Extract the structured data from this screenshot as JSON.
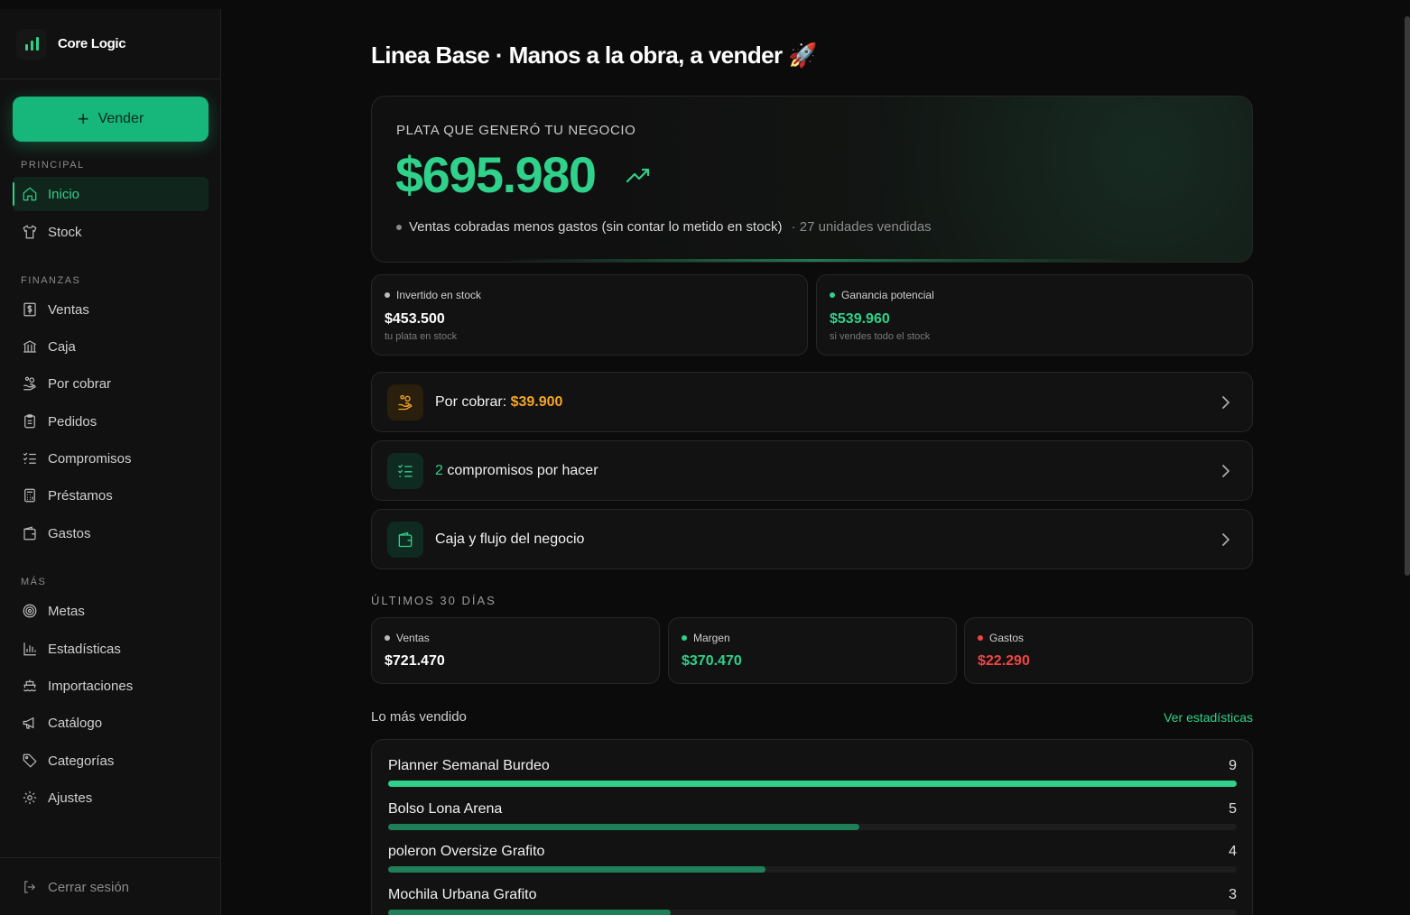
{
  "brand": {
    "name": "Core Logic"
  },
  "sidebar": {
    "sell_label": "Vender",
    "sections": {
      "principal": "PRINCIPAL",
      "finanzas": "FINANZAS",
      "mas": "MÁS"
    },
    "items": [
      {
        "label": "Inicio",
        "icon": "home-icon"
      },
      {
        "label": "Stock",
        "icon": "shirt-icon"
      },
      {
        "label": "Ventas",
        "icon": "dollar-receipt-icon"
      },
      {
        "label": "Caja",
        "icon": "bank-icon"
      },
      {
        "label": "Por cobrar",
        "icon": "hand-coins-icon"
      },
      {
        "label": "Pedidos",
        "icon": "clipboard-icon"
      },
      {
        "label": "Compromisos",
        "icon": "list-checks-icon"
      },
      {
        "label": "Préstamos",
        "icon": "calculator-icon"
      },
      {
        "label": "Gastos",
        "icon": "wallet-icon"
      },
      {
        "label": "Metas",
        "icon": "target-icon"
      },
      {
        "label": "Estadísticas",
        "icon": "bar-chart-icon"
      },
      {
        "label": "Importaciones",
        "icon": "ship-icon"
      },
      {
        "label": "Catálogo",
        "icon": "megaphone-icon"
      },
      {
        "label": "Categorías",
        "icon": "tag-icon"
      },
      {
        "label": "Ajustes",
        "icon": "gear-icon"
      }
    ],
    "logout_label": "Cerrar sesión"
  },
  "header": {
    "title": "Linea Base · Manos a la obra, a vender 🚀"
  },
  "hero": {
    "label": "PLATA QUE GENERÓ TU NEGOCIO",
    "value": "$695.980",
    "note": "Ventas cobradas menos gastos (sin contar lo metido en stock)",
    "units": "· 27 unidades vendidas"
  },
  "stats": {
    "invested": {
      "label": "Invertido en stock",
      "value": "$453.500",
      "sub": "tu plata en stock"
    },
    "potential": {
      "label": "Ganancia potencial",
      "value": "$539.960",
      "sub": "si vendes todo el stock"
    }
  },
  "rows": {
    "receivable": {
      "label": "Por cobrar: ",
      "amount": "$39.900"
    },
    "commitments": {
      "count": "2",
      "label": " compromisos por hacer"
    },
    "cashflow": {
      "label": "Caja y flujo del negocio"
    }
  },
  "last30": {
    "title": "ÚLTIMOS 30 DÍAS",
    "ventas": {
      "label": "Ventas",
      "value": "$721.470"
    },
    "margen": {
      "label": "Margen",
      "value": "$370.470"
    },
    "gastos": {
      "label": "Gastos",
      "value": "$22.290"
    }
  },
  "top": {
    "title": "Lo más vendido",
    "link": "Ver estadísticas",
    "max": 9,
    "products": [
      {
        "name": "Planner Semanal Burdeo",
        "count": 9
      },
      {
        "name": "Bolso Lona Arena",
        "count": 5
      },
      {
        "name": "poleron Oversize Grafito",
        "count": 4
      },
      {
        "name": "Mochila Urbana Grafito",
        "count": 3
      }
    ]
  },
  "colors": {
    "accent": "#2fd18b",
    "warning": "#f5a524",
    "danger": "#ef4444"
  }
}
